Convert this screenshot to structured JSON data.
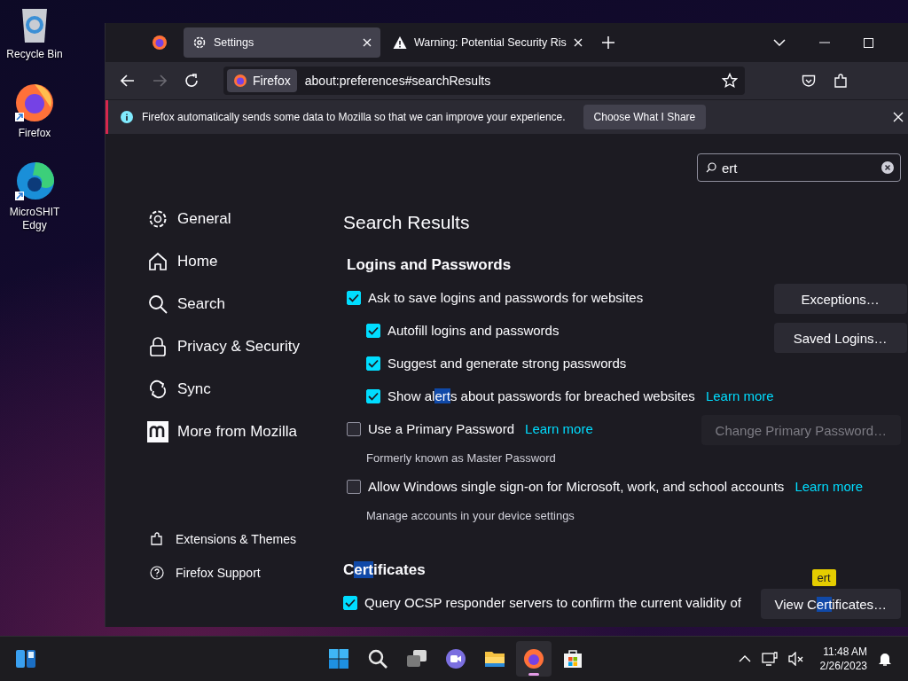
{
  "desktop": {
    "icons": [
      {
        "kind": "recycle",
        "label": "Recycle Bin"
      },
      {
        "kind": "firefox",
        "label": "Firefox"
      },
      {
        "kind": "edge",
        "label": "MicroSHIT Edgy"
      }
    ]
  },
  "browser": {
    "tabs": [
      {
        "kind": "settings",
        "label": "Settings",
        "selected": true
      },
      {
        "kind": "warning",
        "label": "Warning: Potential Security Ris",
        "selected": false
      }
    ],
    "nav": [
      {
        "kind": "back",
        "disabled": false
      },
      {
        "kind": "forward",
        "disabled": true
      },
      {
        "kind": "reload",
        "disabled": false
      }
    ],
    "address_bar": {
      "identity": "Firefox",
      "url": "about:preferences#searchResults"
    },
    "notification": {
      "message": "Firefox automatically sends some data to Mozilla so that we can improve your experience.",
      "button": "Choose What I Share"
    },
    "search": {
      "value": "ert"
    },
    "sidebar": {
      "items": [
        {
          "kind": "gear",
          "label": "General"
        },
        {
          "kind": "home",
          "label": "Home"
        },
        {
          "kind": "search",
          "label": "Search"
        },
        {
          "kind": "lock",
          "label": "Privacy & Security"
        },
        {
          "kind": "sync",
          "label": "Sync"
        },
        {
          "kind": "mozilla",
          "label": "More from Mozilla"
        }
      ],
      "footer": [
        {
          "kind": "puzzle",
          "label": "Extensions & Themes"
        },
        {
          "kind": "help",
          "label": "Firefox Support"
        }
      ]
    },
    "page_title": "Search Results",
    "sections": [
      {
        "heading": [
          {
            "text": "Logins and Passwords",
            "match": false
          }
        ],
        "rows": [
          {
            "kind": "checkbox",
            "checked": true,
            "label": [
              {
                "text": "Ask to save logins and passwords for websites",
                "match": false
              }
            ],
            "buttons": [
              {
                "label": [
                  {
                    "text": "Exceptions…",
                    "match": false
                  }
                ],
                "disabled": false
              },
              {
                "label": [
                  {
                    "text": "Saved Logins…",
                    "match": false
                  }
                ],
                "disabled": false
              }
            ],
            "children": [
              {
                "kind": "checkbox",
                "checked": true,
                "label": [
                  {
                    "text": "Autofill logins and passwords",
                    "match": false
                  }
                ]
              },
              {
                "kind": "checkbox",
                "checked": true,
                "label": [
                  {
                    "text": "Suggest and generate strong passwords",
                    "match": false
                  }
                ]
              },
              {
                "kind": "checkbox",
                "checked": true,
                "label": [
                  {
                    "text": "Show al",
                    "match": false
                  },
                  {
                    "text": "ert",
                    "match": true
                  },
                  {
                    "text": "s about passwords for breached websites",
                    "match": false
                  }
                ],
                "link": "Learn more"
              }
            ]
          },
          {
            "kind": "checkbox",
            "checked": false,
            "label": [
              {
                "text": "Use a Primary Password",
                "match": false
              }
            ],
            "link": "Learn more",
            "buttons": [
              {
                "label": [
                  {
                    "text": "Change Primary Password…",
                    "match": false
                  }
                ],
                "disabled": true
              }
            ]
          },
          {
            "kind": "note",
            "text": "Formerly known as Master Password"
          },
          {
            "kind": "checkbox",
            "checked": false,
            "label": [
              {
                "text": "Allow Windows single sign-on for Microsoft, work, and school accounts",
                "match": false
              }
            ],
            "link": "Learn more"
          },
          {
            "kind": "note",
            "text": "Manage accounts in your device settings"
          }
        ]
      },
      {
        "heading": [
          {
            "text": "C",
            "match": false
          },
          {
            "text": "ert",
            "match": true
          },
          {
            "text": "ificates",
            "match": false
          }
        ],
        "rows": [
          {
            "kind": "checkbox",
            "checked": true,
            "label": [
              {
                "text": "Query OCSP responder servers to confirm the current validity of",
                "match": false
              }
            ],
            "buttons": [
              {
                "label": [
                  {
                    "text": "View C",
                    "match": false
                  },
                  {
                    "text": "ert",
                    "match": true
                  },
                  {
                    "text": "ificates…",
                    "match": false
                  }
                ],
                "disabled": false,
                "tooltip": "ert"
              }
            ]
          }
        ]
      }
    ]
  },
  "taskbar": {
    "apps": [
      {
        "kind": "start",
        "active": false
      },
      {
        "kind": "search",
        "active": false
      },
      {
        "kind": "taskview",
        "active": false
      },
      {
        "kind": "chat",
        "active": false
      },
      {
        "kind": "files",
        "active": false
      },
      {
        "kind": "firefox",
        "active": true
      },
      {
        "kind": "store",
        "active": false
      }
    ],
    "time": "11:48 AM",
    "date": "2/26/2023"
  }
}
